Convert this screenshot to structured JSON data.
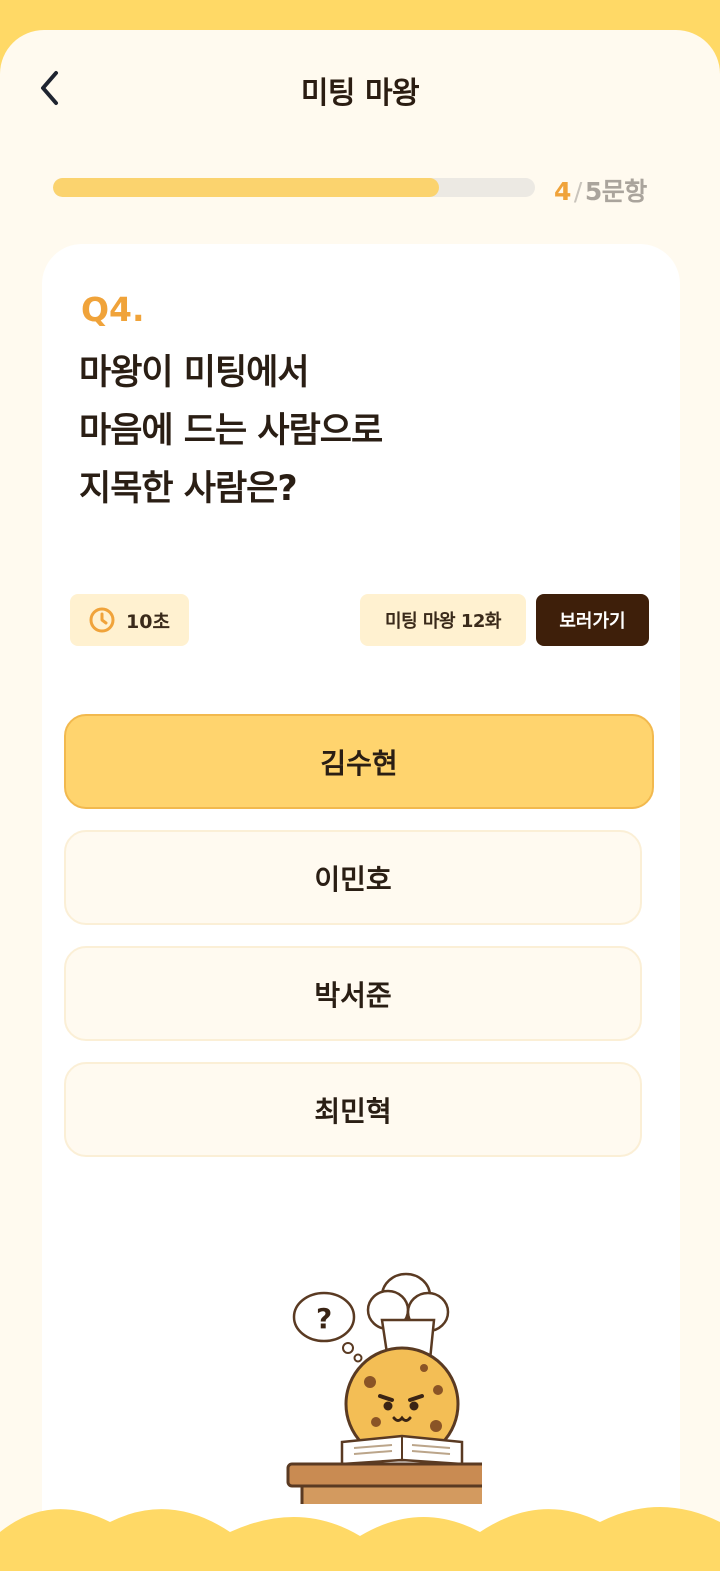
{
  "header": {
    "title": "미팅 마왕"
  },
  "progress": {
    "current": "4",
    "separator": "/",
    "total_label": "5문항",
    "fraction": 0.8
  },
  "question": {
    "number": "Q4.",
    "text": "마왕이 미팅에서\n마음에 드는 사람으로\n지목한 사람은?"
  },
  "timer": {
    "label": "10초",
    "icon": "clock-icon"
  },
  "episode": {
    "label": "미팅 마왕 12화",
    "watch_label": "보러가기"
  },
  "options": [
    {
      "label": "김수현",
      "selected": true
    },
    {
      "label": "이민호",
      "selected": false
    },
    {
      "label": "박서준",
      "selected": false
    },
    {
      "label": "최민혁",
      "selected": false
    }
  ],
  "colors": {
    "accent": "#F0A33A",
    "background": "#FFD966",
    "selected_option": "#FFD46E",
    "dark_button": "#3E1F0A"
  }
}
